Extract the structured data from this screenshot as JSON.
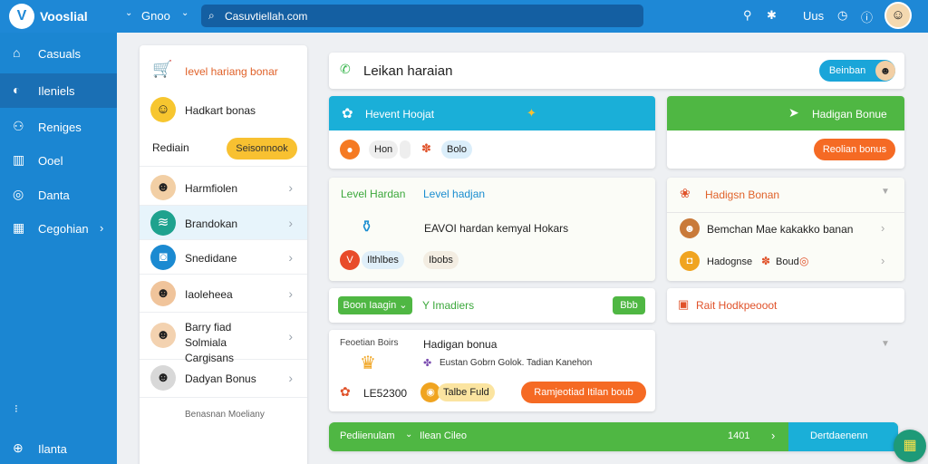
{
  "header": {
    "app_name": "Vooslial",
    "dropdown_label": "Gnoo",
    "search_value": "Casuvtiellah.com",
    "right_label": "Uus"
  },
  "sidebar": {
    "items": [
      {
        "label": "Casuals",
        "icon": "home-icon"
      },
      {
        "label": "Ileniels",
        "icon": "speed-icon"
      },
      {
        "label": "Reniges",
        "icon": "people-icon"
      },
      {
        "label": "Ooel",
        "icon": "chart-icon"
      },
      {
        "label": "Danta",
        "icon": "target-icon"
      },
      {
        "label": "Cegohian",
        "icon": "grid-icon"
      }
    ],
    "bottom_label": "Ilanta"
  },
  "panel": {
    "top_items": [
      "Ievel hariang bonar",
      "Hadkart bonas"
    ],
    "section_label": "Rediain",
    "section_button": "Seisonnook",
    "contacts": [
      "Harmfiolen",
      "Brandokan",
      "Snedidane",
      "Iaoleheea",
      "Barry fiad Solmiala Cargisans",
      "Dadyan Bonus"
    ],
    "footer": "Benasnan Moeliany"
  },
  "main": {
    "top_title": "Leikan haraian",
    "top_button": "Beinban",
    "blue_card": {
      "title": "Hevent Hoojat",
      "chip1": "Hon",
      "chip2": "Bolo"
    },
    "green_card": {
      "title": "Hadigan Bonue",
      "button": "Reolian bonus"
    },
    "level_card": {
      "tab1": "Level Hardan",
      "tab2": "Level hadjan",
      "main_text": "EAVOI hardan kemyal Hokars",
      "chip1": "Ilthlbes",
      "chip2": "Ibobs"
    },
    "bonus_list": {
      "title": "Hadigsn Bonan",
      "item1": "Bemchan Mae kakakko banan",
      "item2_a": "Hadognse",
      "item2_b": "Boud"
    },
    "bar_row": {
      "pill1": "Boon Iaagin",
      "text": "Y Imadiers",
      "pill2": "Bbb"
    },
    "rait_card": {
      "label": "Rait Hodkpeooot"
    },
    "bottom_card": {
      "left_label": "Feoetian Boirs",
      "title": "Hadigan bonua",
      "desc": "Eustan Gobrn Golok. Tadian Kanehon",
      "code": "LE52300",
      "chip": "Talbe Fuld",
      "button": "Ramjeotiad Itilan boub"
    },
    "green_bar": {
      "label": "Pediienulam",
      "label2": "Ilean Cileo",
      "count": "1401",
      "button": "Dertdaenenn"
    }
  }
}
